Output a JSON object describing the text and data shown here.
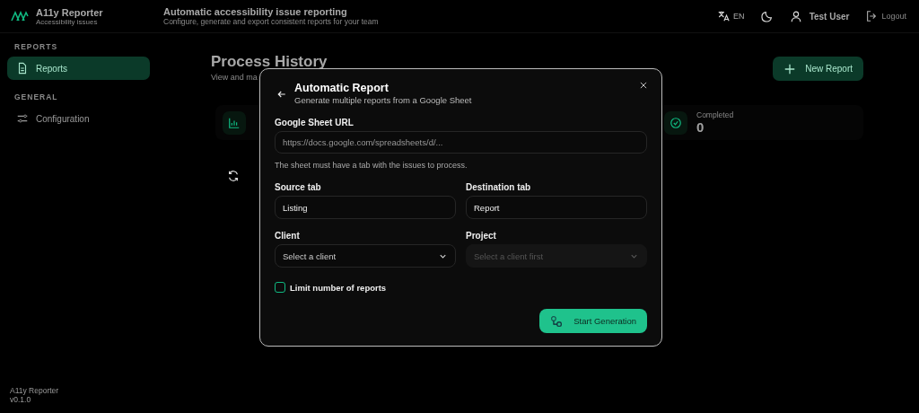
{
  "app": {
    "name": "A11y Reporter",
    "tagline": "Accessibility issues"
  },
  "header": {
    "title": "Automatic accessibility issue reporting",
    "subtitle": "Configure, generate and export consistent reports for your team",
    "language": "EN",
    "user": "Test User",
    "logout": "Logout"
  },
  "sidebar": {
    "sections": [
      {
        "heading": "REPORTS",
        "items": [
          {
            "label": "Reports",
            "selected": true
          }
        ]
      },
      {
        "heading": "GENERAL",
        "items": [
          {
            "label": "Configuration",
            "selected": false
          }
        ]
      }
    ]
  },
  "footer": {
    "name": "A11y Reporter",
    "version": "v0.1.0"
  },
  "page": {
    "title": "Process History",
    "subtitle": "View and ma",
    "new_button": "New Report",
    "stat": {
      "label": "Completed",
      "value": "0"
    }
  },
  "dialog": {
    "title": "Automatic Report",
    "subtitle": "Generate multiple reports from a Google Sheet",
    "url": {
      "label": "Google Sheet URL",
      "placeholder": "https://docs.google.com/spreadsheets/d/...",
      "hint": "The sheet must have a tab with the issues to process."
    },
    "fields": [
      {
        "kind": "input",
        "label": "Source tab",
        "value": "Listing",
        "disabled": false
      },
      {
        "kind": "input",
        "label": "Destination tab",
        "value": "Report",
        "disabled": false
      },
      {
        "kind": "select",
        "label": "Client",
        "placeholder": "Select a client",
        "disabled": false
      },
      {
        "kind": "select",
        "label": "Project",
        "placeholder": "Select a client first",
        "disabled": true
      }
    ],
    "limit": {
      "label": "Limit number of reports",
      "checked": false
    },
    "submit": "Start Generation"
  }
}
